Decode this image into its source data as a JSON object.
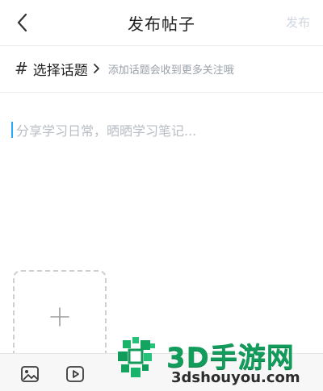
{
  "header": {
    "title": "发布帖子",
    "publish_label": "发布"
  },
  "topic": {
    "hash": "#",
    "label": "选择话题",
    "hint": "添加话题会收到更多关注哦"
  },
  "editor": {
    "placeholder": "分享学习日常，晒晒学习笔记..."
  },
  "toolbar": {
    "items": [
      "image-icon",
      "video-icon"
    ]
  },
  "watermark": {
    "title": "3D手游网",
    "url": "3dshouyou.com"
  },
  "colors": {
    "accent_caret": "#2aa7ff",
    "publish_disabled": "#cfd6dd",
    "watermark_green": "#119c5b"
  }
}
